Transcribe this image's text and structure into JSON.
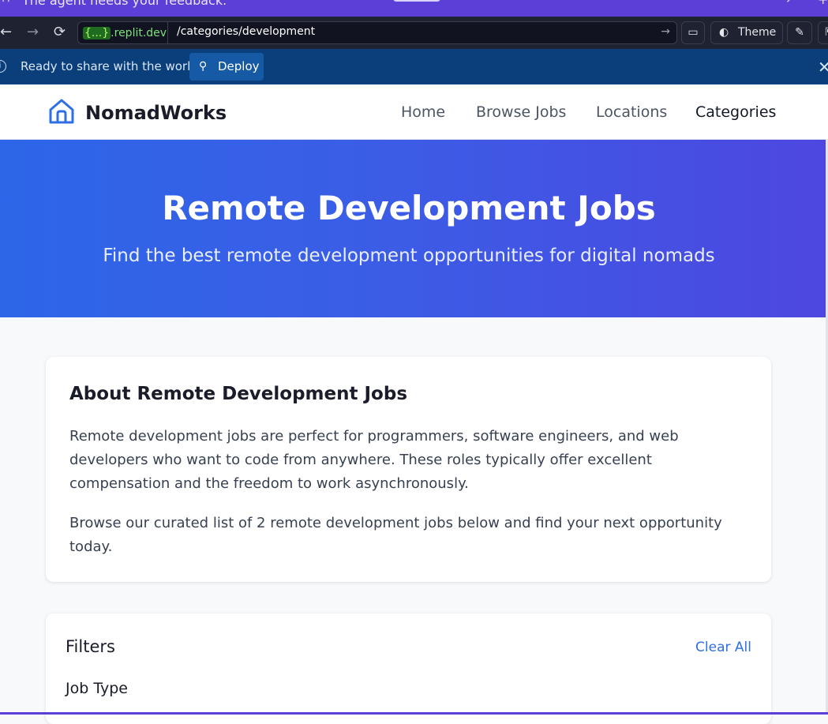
{
  "notification": {
    "message": "The agent needs your feedback."
  },
  "browser": {
    "url_domain_brace": "{...}",
    "url_domain": ".replit.dev",
    "url_path": "/categories/development",
    "theme_label": "Theme"
  },
  "deploy_bar": {
    "message": "Ready to share with the world?",
    "deploy_label": "Deploy"
  },
  "site": {
    "brand": "NomadWorks",
    "nav": {
      "home": "Home",
      "browse_jobs": "Browse Jobs",
      "locations": "Locations",
      "categories": "Categories"
    }
  },
  "hero": {
    "title": "Remote Development Jobs",
    "subtitle": "Find the best remote development opportunities for digital nomads"
  },
  "about": {
    "heading": "About Remote Development Jobs",
    "paragraph1": "Remote development jobs are perfect for programmers, software engineers, and web developers who want to code from anywhere. These roles typically offer excellent compensation and the freedom to work asynchronously.",
    "paragraph2": "Browse our curated list of 2 remote development jobs below and find your next opportunity today."
  },
  "filters": {
    "title": "Filters",
    "clear_all": "Clear All",
    "job_type_label": "Job Type"
  },
  "colors": {
    "brand_blue": "#2f6fe4",
    "hero_start": "#2d66e8",
    "hero_end": "#4d47e0",
    "deploy_bar": "#0a3f7c"
  }
}
